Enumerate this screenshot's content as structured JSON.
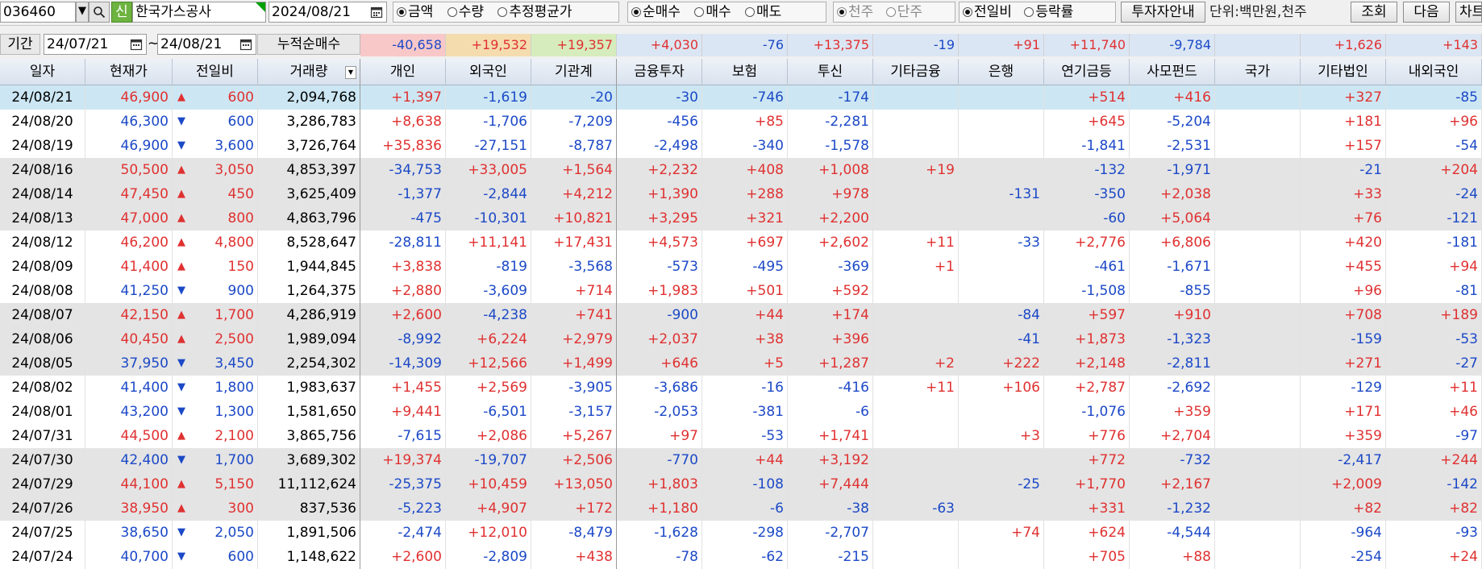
{
  "toolbar": {
    "code": "036460",
    "dropdown_arrow": "▼",
    "search_icon": "search-icon",
    "sin_badge": "신",
    "company": "한국가스공사",
    "date": "2024/08/21",
    "calendar_icon": "calendar-icon",
    "group1": [
      {
        "label": "금액",
        "on": true
      },
      {
        "label": "수량",
        "on": false
      },
      {
        "label": "추정평균가",
        "on": false
      }
    ],
    "group2": [
      {
        "label": "순매수",
        "on": true
      },
      {
        "label": "매수",
        "on": false
      },
      {
        "label": "매도",
        "on": false
      }
    ],
    "group3": [
      {
        "label": "천주",
        "on": true
      },
      {
        "label": "단주",
        "on": false
      }
    ],
    "group4": [
      {
        "label": "전일비",
        "on": true
      },
      {
        "label": "등락률",
        "on": false
      }
    ],
    "investor_guide": "투자자안내",
    "unit": "단위:백만원,천주",
    "search_btn": "조회",
    "next_btn": "다음",
    "chart_btn": "차트"
  },
  "period": {
    "label": "기간",
    "start": "24/07/21",
    "tilde": "~",
    "end": "24/08/21",
    "cum_label": "누적순매수"
  },
  "cumulative": {
    "개인": "-40,658",
    "외국인": "+19,532",
    "기관계": "+19,357",
    "금융투자": "+4,030",
    "보험": "-76",
    "투신": "+13,375",
    "기타금융": "-19",
    "은행": "+91",
    "연기금등": "+11,740",
    "사모펀드": "-9,784",
    "국가": "",
    "기타법인": "+1,626",
    "내외국인": "+143"
  },
  "colors": {
    "up": "#e03131",
    "down": "#1c49c7",
    "selected_row": "#cce7f3",
    "shaded_row": "#e4e4e4",
    "cum_indiv": "#f8c8c8",
    "cum_foreign": "#f4dcaf",
    "cum_inst": "#d6ecbc",
    "cum_rest": "#dbe6f4"
  },
  "columns": [
    "일자",
    "현재가",
    "전일비",
    "거래량",
    "개인",
    "외국인",
    "기관계",
    "금융투자",
    "보험",
    "투신",
    "기타금융",
    "은행",
    "연기금등",
    "사모펀드",
    "국가",
    "기타법인",
    "내외국인"
  ],
  "sort_icon": "sort-down-icon",
  "rows": [
    {
      "date": "24/08/21",
      "price": "46,900",
      "dir": "up",
      "chg": "600",
      "vol": "2,094,768",
      "v": [
        "+1,397",
        "-1,619",
        "-20",
        "-30",
        "-746",
        "-174",
        "",
        "",
        "+514",
        "+416",
        "",
        "+327",
        "-85"
      ]
    },
    {
      "date": "24/08/20",
      "price": "46,300",
      "dir": "down",
      "chg": "600",
      "vol": "3,286,783",
      "v": [
        "+8,638",
        "-1,706",
        "-7,209",
        "-456",
        "+85",
        "-2,281",
        "",
        "",
        "+645",
        "-5,204",
        "",
        "+181",
        "+96"
      ]
    },
    {
      "date": "24/08/19",
      "price": "46,900",
      "dir": "down",
      "chg": "3,600",
      "vol": "3,726,764",
      "v": [
        "+35,836",
        "-27,151",
        "-8,787",
        "-2,498",
        "-340",
        "-1,578",
        "",
        "",
        "-1,841",
        "-2,531",
        "",
        "+157",
        "-54"
      ]
    },
    {
      "date": "24/08/16",
      "price": "50,500",
      "dir": "up",
      "chg": "3,050",
      "vol": "4,853,397",
      "v": [
        "-34,753",
        "+33,005",
        "+1,564",
        "+2,232",
        "+408",
        "+1,008",
        "+19",
        "",
        "-132",
        "-1,971",
        "",
        "-21",
        "+204"
      ]
    },
    {
      "date": "24/08/14",
      "price": "47,450",
      "dir": "up",
      "chg": "450",
      "vol": "3,625,409",
      "v": [
        "-1,377",
        "-2,844",
        "+4,212",
        "+1,390",
        "+288",
        "+978",
        "",
        "-131",
        "-350",
        "+2,038",
        "",
        "+33",
        "-24"
      ]
    },
    {
      "date": "24/08/13",
      "price": "47,000",
      "dir": "up",
      "chg": "800",
      "vol": "4,863,796",
      "v": [
        "-475",
        "-10,301",
        "+10,821",
        "+3,295",
        "+321",
        "+2,200",
        "",
        "",
        "-60",
        "+5,064",
        "",
        "+76",
        "-121"
      ]
    },
    {
      "date": "24/08/12",
      "price": "46,200",
      "dir": "up",
      "chg": "4,800",
      "vol": "8,528,647",
      "v": [
        "-28,811",
        "+11,141",
        "+17,431",
        "+4,573",
        "+697",
        "+2,602",
        "+11",
        "-33",
        "+2,776",
        "+6,806",
        "",
        "+420",
        "-181"
      ]
    },
    {
      "date": "24/08/09",
      "price": "41,400",
      "dir": "up",
      "chg": "150",
      "vol": "1,944,845",
      "v": [
        "+3,838",
        "-819",
        "-3,568",
        "-573",
        "-495",
        "-369",
        "+1",
        "",
        "-461",
        "-1,671",
        "",
        "+455",
        "+94"
      ]
    },
    {
      "date": "24/08/08",
      "price": "41,250",
      "dir": "down",
      "chg": "900",
      "vol": "1,264,375",
      "v": [
        "+2,880",
        "-3,609",
        "+714",
        "+1,983",
        "+501",
        "+592",
        "",
        "",
        "-1,508",
        "-855",
        "",
        "+96",
        "-81"
      ]
    },
    {
      "date": "24/08/07",
      "price": "42,150",
      "dir": "up",
      "chg": "1,700",
      "vol": "4,286,919",
      "v": [
        "+2,600",
        "-4,238",
        "+741",
        "-900",
        "+44",
        "+174",
        "",
        "-84",
        "+597",
        "+910",
        "",
        "+708",
        "+189"
      ]
    },
    {
      "date": "24/08/06",
      "price": "40,450",
      "dir": "up",
      "chg": "2,500",
      "vol": "1,989,094",
      "v": [
        "-8,992",
        "+6,224",
        "+2,979",
        "+2,037",
        "+38",
        "+396",
        "",
        "-41",
        "+1,873",
        "-1,323",
        "",
        "-159",
        "-53"
      ]
    },
    {
      "date": "24/08/05",
      "price": "37,950",
      "dir": "down",
      "chg": "3,450",
      "vol": "2,254,302",
      "v": [
        "-14,309",
        "+12,566",
        "+1,499",
        "+646",
        "+5",
        "+1,287",
        "+2",
        "+222",
        "+2,148",
        "-2,811",
        "",
        "+271",
        "-27"
      ]
    },
    {
      "date": "24/08/02",
      "price": "41,400",
      "dir": "down",
      "chg": "1,800",
      "vol": "1,983,637",
      "v": [
        "+1,455",
        "+2,569",
        "-3,905",
        "-3,686",
        "-16",
        "-416",
        "+11",
        "+106",
        "+2,787",
        "-2,692",
        "",
        "-129",
        "+11"
      ]
    },
    {
      "date": "24/08/01",
      "price": "43,200",
      "dir": "down",
      "chg": "1,300",
      "vol": "1,581,650",
      "v": [
        "+9,441",
        "-6,501",
        "-3,157",
        "-2,053",
        "-381",
        "-6",
        "",
        "",
        "-1,076",
        "+359",
        "",
        "+171",
        "+46"
      ]
    },
    {
      "date": "24/07/31",
      "price": "44,500",
      "dir": "up",
      "chg": "2,100",
      "vol": "3,865,756",
      "v": [
        "-7,615",
        "+2,086",
        "+5,267",
        "+97",
        "-53",
        "+1,741",
        "",
        "+3",
        "+776",
        "+2,704",
        "",
        "+359",
        "-97"
      ]
    },
    {
      "date": "24/07/30",
      "price": "42,400",
      "dir": "down",
      "chg": "1,700",
      "vol": "3,689,302",
      "v": [
        "+19,374",
        "-19,707",
        "+2,506",
        "-770",
        "+44",
        "+3,192",
        "",
        "",
        "+772",
        "-732",
        "",
        "-2,417",
        "+244"
      ]
    },
    {
      "date": "24/07/29",
      "price": "44,100",
      "dir": "up",
      "chg": "5,150",
      "vol": "11,112,624",
      "v": [
        "-25,375",
        "+10,459",
        "+13,050",
        "+1,803",
        "-108",
        "+7,444",
        "",
        "-25",
        "+1,770",
        "+2,167",
        "",
        "+2,009",
        "-142"
      ]
    },
    {
      "date": "24/07/26",
      "price": "38,950",
      "dir": "up",
      "chg": "300",
      "vol": "837,536",
      "v": [
        "-5,223",
        "+4,907",
        "+172",
        "+1,180",
        "-6",
        "-38",
        "-63",
        "",
        "+331",
        "-1,232",
        "",
        "+82",
        "+82"
      ]
    },
    {
      "date": "24/07/25",
      "price": "38,650",
      "dir": "down",
      "chg": "2,050",
      "vol": "1,891,506",
      "v": [
        "-2,474",
        "+12,010",
        "-8,479",
        "-1,628",
        "-298",
        "-2,707",
        "",
        "+74",
        "+624",
        "-4,544",
        "",
        "-964",
        "-93"
      ]
    },
    {
      "date": "24/07/24",
      "price": "40,700",
      "dir": "down",
      "chg": "600",
      "vol": "1,148,622",
      "v": [
        "+2,600",
        "-2,809",
        "+438",
        "-78",
        "-62",
        "-215",
        "",
        "",
        "+705",
        "+88",
        "",
        "-254",
        "+24"
      ]
    }
  ]
}
